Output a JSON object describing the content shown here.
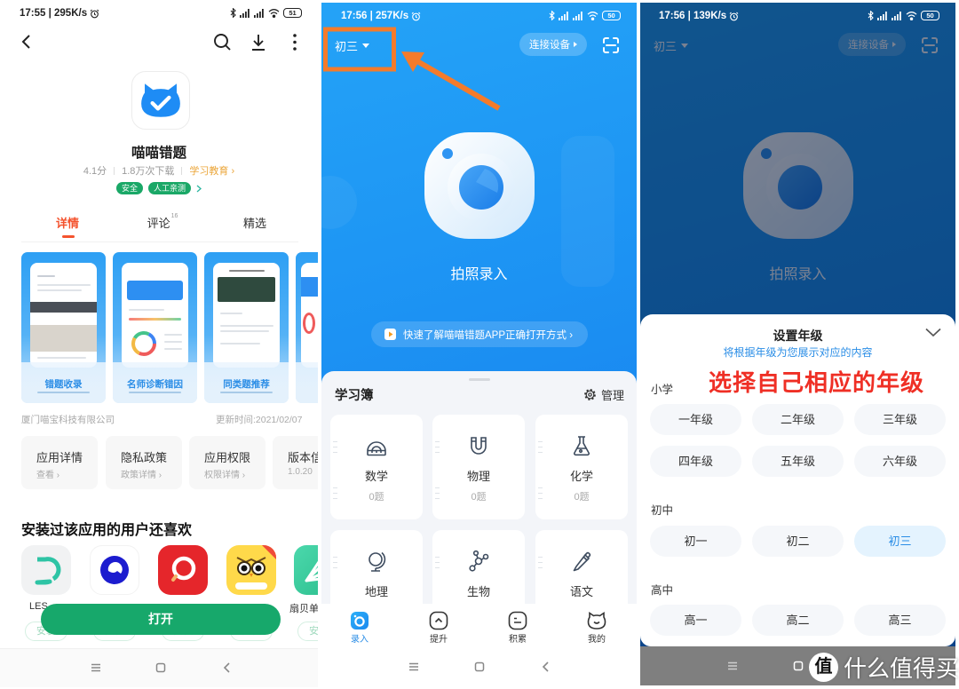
{
  "store_page": {
    "status_bar": {
      "time": "17:55 | 295K/s",
      "battery": "51"
    },
    "app": {
      "name": "喵喵错题",
      "rating": "4.1分",
      "downloads": "1.8万次下载",
      "category": "学习教育 ›",
      "tags": [
        "安全",
        "人工亲测"
      ]
    },
    "tabs": [
      {
        "label": "详情",
        "badge": "",
        "active": true
      },
      {
        "label": "评论",
        "badge": "16",
        "active": false
      },
      {
        "label": "精选",
        "badge": "",
        "active": false
      }
    ],
    "screenshots": [
      {
        "caption": "错题收录"
      },
      {
        "caption": "名师诊断错因"
      },
      {
        "caption": "同类题推荐"
      }
    ],
    "developer": "厦门喵宝科技有限公司",
    "update_time": "更新时间:2021/02/07",
    "info_cards": [
      {
        "title": "应用详情",
        "subtitle": "查看 ›"
      },
      {
        "title": "隐私政策",
        "subtitle": "政策详情 ›"
      },
      {
        "title": "应用权限",
        "subtitle": "权限详情 ›"
      },
      {
        "title": "版本信息",
        "subtitle": "1.0.20"
      }
    ],
    "recommend": {
      "title": "安装过该应用的用户还喜欢",
      "apps": [
        {
          "name": "LES",
          "icon": "teal-d-logo-icon"
        },
        {
          "name": "",
          "icon": "blue-ring-logo-icon"
        },
        {
          "name": "",
          "icon": "red-magnifier-logo-icon"
        },
        {
          "name": "",
          "icon": "owl-logo-icon"
        },
        {
          "name": "扇贝单",
          "icon": "green-rays-logo-icon"
        }
      ],
      "install_label": "安装"
    },
    "open_button": "打开"
  },
  "home_page": {
    "status_bar": {
      "time": "17:56 | 257K/s",
      "battery": "50"
    },
    "grade_selector": "初三",
    "connect_button": "连接设备",
    "camera_label": "拍照录入",
    "guide_link": "快速了解喵喵错题APP正确打开方式 ›",
    "notebook": {
      "title": "学习簿",
      "manage": "管理",
      "subjects": [
        {
          "name": "数学",
          "count": "0题",
          "icon": "protractor-icon"
        },
        {
          "name": "物理",
          "count": "0题",
          "icon": "magnet-icon"
        },
        {
          "name": "化学",
          "count": "0题",
          "icon": "flask-icon"
        },
        {
          "name": "地理",
          "icon": "globe-icon"
        },
        {
          "name": "生物",
          "icon": "molecule-icon"
        },
        {
          "name": "语文",
          "icon": "pencil-icon"
        }
      ]
    },
    "bottom_tabs": [
      {
        "label": "录入",
        "icon": "camera-icon",
        "active": true
      },
      {
        "label": "提升",
        "icon": "level-up-icon",
        "active": false
      },
      {
        "label": "积累",
        "icon": "notes-icon",
        "active": false
      },
      {
        "label": "我的",
        "icon": "cat-face-icon",
        "active": false
      }
    ]
  },
  "grade_page": {
    "status_bar": {
      "time": "17:56 | 139K/s",
      "battery": "50"
    },
    "grade_selector": "初三",
    "connect_button": "连接设备",
    "camera_label": "拍照录入",
    "sheet": {
      "title": "设置年级",
      "subtitle": "将根据年级为您展示对应的内容",
      "selected": "初三",
      "sections": [
        {
          "label": "小学",
          "grades": [
            "一年级",
            "二年级",
            "三年级",
            "四年级",
            "五年级",
            "六年级"
          ]
        },
        {
          "label": "初中",
          "grades": [
            "初一",
            "初二",
            "初三"
          ]
        },
        {
          "label": "高中",
          "grades": [
            "高一",
            "高二",
            "高三"
          ]
        }
      ]
    }
  },
  "annotations": {
    "callout_text": "选择自己相应的年级"
  },
  "watermark": {
    "badge": "值",
    "text": "什么值得买"
  },
  "colors": {
    "brand_green": "#17a86b",
    "tab_active": "#f4532e",
    "category_orange": "#eba63a",
    "app_blue": "#1e8cf5",
    "selected_blue": "#2a8de6",
    "annotation_orange": "#f47b2b",
    "annotation_red": "#ef2f25"
  }
}
